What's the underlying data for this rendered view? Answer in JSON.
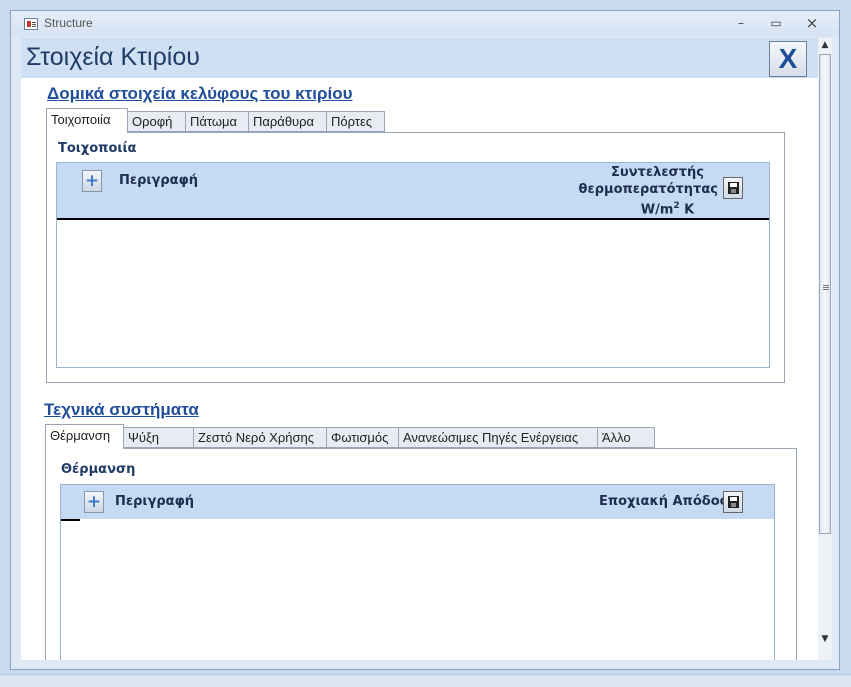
{
  "window": {
    "title": "Structure",
    "minimize_label": "–",
    "maximize_label": "▭",
    "close_label": "×"
  },
  "form": {
    "title": "Στοιχεία Κτιρίου",
    "close_button_label": "X"
  },
  "structure_section": {
    "title": "Δομικά στοιχεία κελύφους του κτιρίου",
    "tabs": [
      {
        "label": "Τοιχοποιία",
        "active": true
      },
      {
        "label": "Οροφή",
        "active": false
      },
      {
        "label": "Πάτωμα",
        "active": false
      },
      {
        "label": "Παράθυρα",
        "active": false
      },
      {
        "label": "Πόρτες",
        "active": false
      }
    ],
    "panel_label": "Τοιχοποιία",
    "subform": {
      "add_label": "+",
      "col_description": "Περιγραφή",
      "col_value_line1": "Συντελεστής",
      "col_value_line2": "θερμοπερατότητας",
      "col_value_unit": "W/m",
      "col_value_unit_sup": "2",
      "col_value_unit_suffix": "K"
    }
  },
  "systems_section": {
    "title": "Τεχνικά συστήματα",
    "tabs": [
      {
        "label": "Θέρμανση",
        "active": true
      },
      {
        "label": "Ψύξη",
        "active": false
      },
      {
        "label": "Ζεστό Νερό Χρήσης",
        "active": false
      },
      {
        "label": "Φωτισμός",
        "active": false
      },
      {
        "label": "Ανανεώσιμες Πηγές Ενέργειας",
        "active": false
      },
      {
        "label": "Άλλο",
        "active": false
      }
    ],
    "panel_label": "Θέρμανση",
    "subform": {
      "add_label": "+",
      "col_description": "Περιγραφή",
      "col_value": "Εποχιακή Απόδοση"
    }
  },
  "scrollbar": {
    "up_arrow": "▲",
    "down_arrow": "▼"
  }
}
